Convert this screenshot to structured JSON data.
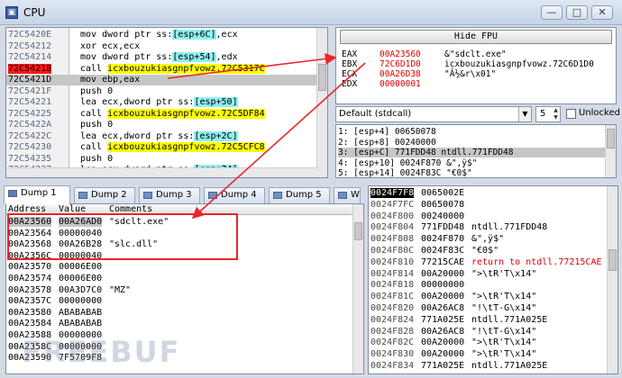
{
  "window": {
    "title": "CPU",
    "min": "—",
    "max": "□",
    "close": "✕"
  },
  "disasm": [
    {
      "addr": "72C5420E",
      "pre": "mov dword ptr ss:",
      "hl": "[esp+6C]",
      "hlc": "c",
      "post": ",ecx",
      "style": ""
    },
    {
      "addr": "72C54212",
      "pre": "xor ecx,ecx",
      "hl": "",
      "hlc": "",
      "post": "",
      "style": ""
    },
    {
      "addr": "72C54214",
      "pre": "mov dword ptr ss:",
      "hl": "[esp+54]",
      "hlc": "c",
      "post": ",edx",
      "style": ""
    },
    {
      "addr": "72C54218",
      "pre": "call ",
      "hl": "icxbouzukiasgnpfvowz.72C5317C",
      "hlc": "y",
      "post": "",
      "style": "sel"
    },
    {
      "addr": "72C5421D",
      "pre": "mov ebp,eax",
      "hl": "",
      "hlc": "",
      "post": "",
      "style": "cur"
    },
    {
      "addr": "72C5421F",
      "pre": "push 0",
      "hl": "",
      "hlc": "",
      "post": "",
      "style": ""
    },
    {
      "addr": "72C54221",
      "pre": "lea ecx,dword ptr ss:",
      "hl": "[esp+50]",
      "hlc": "c",
      "post": "",
      "style": ""
    },
    {
      "addr": "72C54225",
      "pre": "call ",
      "hl": "icxbouzukiasgnpfvowz.72C5DF84",
      "hlc": "y",
      "post": "",
      "style": ""
    },
    {
      "addr": "72C5422A",
      "pre": "push 0",
      "hl": "",
      "hlc": "",
      "post": "",
      "style": ""
    },
    {
      "addr": "72C5422C",
      "pre": "lea ecx,dword ptr ss:",
      "hl": "[esp+2C]",
      "hlc": "c",
      "post": "",
      "style": ""
    },
    {
      "addr": "72C54230",
      "pre": "call ",
      "hl": "icxbouzukiasgnpfvowz.72C5CFC8",
      "hlc": "y",
      "post": "",
      "style": ""
    },
    {
      "addr": "72C54235",
      "pre": "push 0",
      "hl": "",
      "hlc": "",
      "post": "",
      "style": ""
    },
    {
      "addr": "72C54237",
      "pre": "lea ecx,dword ptr ss:",
      "hl": "[esp+74]",
      "hlc": "c",
      "post": "",
      "style": ""
    }
  ],
  "regs": {
    "hide_fpu": "Hide FPU",
    "rows": [
      {
        "name": "EAX",
        "val": "00A23560",
        "comment": "&\"sdclt.exe\""
      },
      {
        "name": "EBX",
        "val": "72C6D1D0",
        "comment": "icxbouzukiasgnpfvowz.72C6D1D0"
      },
      {
        "name": "ECX",
        "val": "00A26D38",
        "comment": "\"Â½&r\\x01\""
      },
      {
        "name": "EDX",
        "val": "00000001",
        "comment": ""
      }
    ]
  },
  "callconv": {
    "value": "Default (stdcall)",
    "count": "5",
    "unlocked": "Unlocked"
  },
  "args": [
    "1: [esp+4] 00650078",
    "2: [esp+8] 00240000",
    "3: [esp+C] 771FDD48 ntdll.771FDD48",
    "4: [esp+10] 0024F870 &\",ÿ$\"",
    "5: [esp+14] 0024F83C \"€0$\""
  ],
  "tabs": [
    "Dump 1",
    "Dump 2",
    "Dump 3",
    "Dump 4",
    "Dump 5",
    "W"
  ],
  "dump": {
    "headers": {
      "address": "Address",
      "value": "Value",
      "comments": "Comments"
    },
    "rows": [
      {
        "a": "00A23560",
        "v": "00A26AD0",
        "c": "\"sdclt.exe\""
      },
      {
        "a": "00A23564",
        "v": "00000040",
        "c": ""
      },
      {
        "a": "00A23568",
        "v": "00A26B28",
        "c": "\"slc.dll\""
      },
      {
        "a": "00A2356C",
        "v": "00000040",
        "c": ""
      },
      {
        "a": "00A23570",
        "v": "00006E00",
        "c": ""
      },
      {
        "a": "00A23574",
        "v": "00006E00",
        "c": ""
      },
      {
        "a": "00A23578",
        "v": "00A3D7C0",
        "c": "\"MZ\""
      },
      {
        "a": "00A2357C",
        "v": "00000000",
        "c": ""
      },
      {
        "a": "00A23580",
        "v": "ABABABAB",
        "c": ""
      },
      {
        "a": "00A23584",
        "v": "ABABABAB",
        "c": ""
      },
      {
        "a": "00A23588",
        "v": "00000000",
        "c": ""
      },
      {
        "a": "00A2358C",
        "v": "00000000",
        "c": ""
      },
      {
        "a": "00A23590",
        "v": "7F5709F8",
        "c": ""
      }
    ]
  },
  "stack": [
    {
      "a": "0024F7F8",
      "v": "0065002E",
      "c": "",
      "red": false
    },
    {
      "a": "0024F7FC",
      "v": "00650078",
      "c": "",
      "red": false
    },
    {
      "a": "0024F800",
      "v": "00240000",
      "c": "",
      "red": false
    },
    {
      "a": "0024F804",
      "v": "771FDD48",
      "c": "ntdll.771FDD48",
      "red": false
    },
    {
      "a": "0024F808",
      "v": "0024F870",
      "c": "&\",ÿ$\"",
      "red": false
    },
    {
      "a": "0024F80C",
      "v": "0024F83C",
      "c": "\"€0$\"",
      "red": false
    },
    {
      "a": "0024F810",
      "v": "77215CAE",
      "c": "return to ntdll.77215CAE",
      "red": true
    },
    {
      "a": "0024F814",
      "v": "00A20000",
      "c": "\">\\tR'T\\x14\"",
      "red": false
    },
    {
      "a": "0024F818",
      "v": "00000000",
      "c": "",
      "red": false
    },
    {
      "a": "0024F81C",
      "v": "00A20000",
      "c": "\">\\tR'T\\x14\"",
      "red": false
    },
    {
      "a": "0024F820",
      "v": "00A26AC8",
      "c": "\"!\\tT-G\\x14\"",
      "red": false
    },
    {
      "a": "0024F824",
      "v": "771A025E",
      "c": "ntdll.771A025E",
      "red": false
    },
    {
      "a": "0024F828",
      "v": "00A26AC8",
      "c": "\"!\\tT-G\\x14\"",
      "red": false
    },
    {
      "a": "0024F82C",
      "v": "00A20000",
      "c": "\">\\tR'T\\x14\"",
      "red": false
    },
    {
      "a": "0024F830",
      "v": "00A20000",
      "c": "\">\\tR'T\\x14\"",
      "red": false
    },
    {
      "a": "0024F834",
      "v": "771A025E",
      "c": "ntdll.771A025E",
      "red": false
    }
  ],
  "watermark": "FREEBUF",
  "colors": {
    "accent_red": "#e8262b",
    "highlight_yellow": "#ffff00",
    "highlight_cyan": "#8ef0f0",
    "reg_value_red": "#e00000"
  }
}
